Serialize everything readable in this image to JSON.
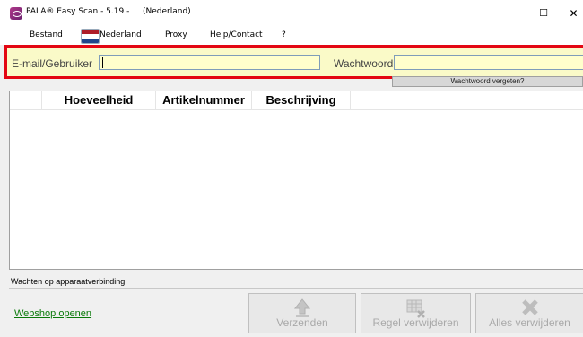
{
  "window": {
    "title": "PALA® Easy Scan  - 5.19 -",
    "subtitle": "(Nederland)",
    "controls": {
      "minimize": "–",
      "maximize": "☐",
      "close": "✕"
    }
  },
  "menu": {
    "items": [
      "Bestand",
      "Nederland",
      "Proxy",
      "Help/Contact",
      "?"
    ],
    "flag_colors": [
      "#ae1c28",
      "#ffffff",
      "#21468b"
    ]
  },
  "login": {
    "email_label": "E-mail/Gebruiker",
    "email_value": "",
    "password_label": "Wachtwoord",
    "password_value": "",
    "forgot_label": "Wachtwoord vergeten?",
    "highlight_color": "#e30613"
  },
  "table": {
    "columns": [
      "Hoeveelheid",
      "Artikelnummer",
      "Beschrijving"
    ],
    "rows": []
  },
  "status_text": "Wachten op apparaatverbinding",
  "webshop_link": "Webshop openen",
  "actions": {
    "send": "Verzenden",
    "remove_row": "Regel verwijderen",
    "remove_all": "Alles verwijderen"
  }
}
